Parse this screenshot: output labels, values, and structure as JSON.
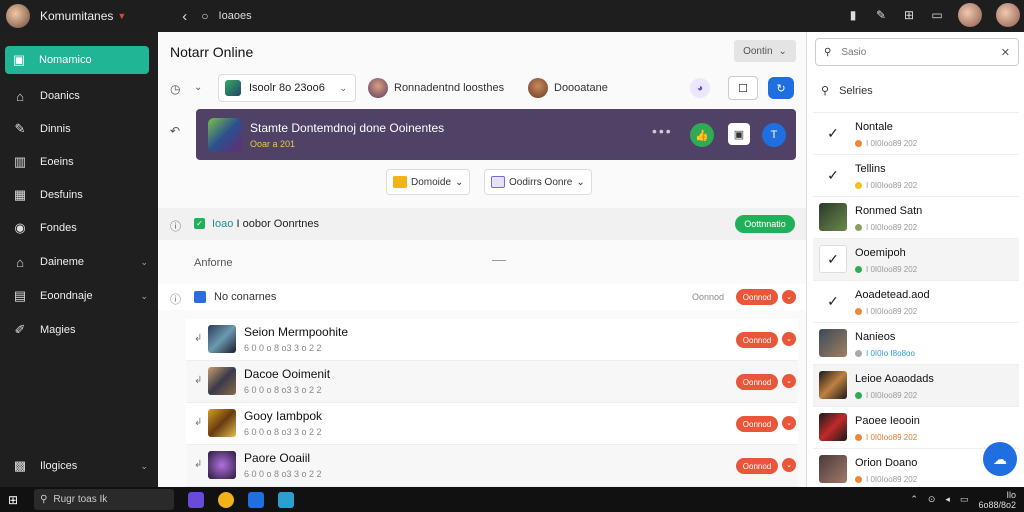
{
  "topbar": {
    "app_name": "Komumitanes",
    "search_text": "Ioaoes",
    "icons": [
      "back-icon",
      "search-icon",
      "bookmark-icon",
      "pin-icon",
      "grid-icon",
      "window-icon"
    ]
  },
  "sidebar": {
    "items": [
      {
        "label": "Nomamico",
        "icon": "chat-icon",
        "active": true
      },
      {
        "label": "Doanics",
        "icon": "home-icon"
      },
      {
        "label": "Dinnis",
        "icon": "pen-icon"
      },
      {
        "label": "Eoeins",
        "icon": "calendar-icon"
      },
      {
        "label": "Desfuins",
        "icon": "grid-icon"
      },
      {
        "label": "Fondes",
        "icon": "target-icon"
      },
      {
        "label": "Daineme",
        "icon": "home-icon"
      },
      {
        "label": "Eoondnaje",
        "icon": "box-icon"
      },
      {
        "label": "Magies",
        "icon": "pen-icon"
      },
      {
        "label": "Ilogices",
        "icon": "settings-icon"
      }
    ]
  },
  "main": {
    "title": "Notarr Online",
    "top_button": "Oontin",
    "select_value": "Isoolr 8o 23oo6",
    "person1": "Ronnadentnd loosthes",
    "person2": "Doooatane",
    "banner": {
      "title": "Stamte Dontemdnoj done Ooinentes",
      "subtitle": "Ooar a 201"
    },
    "dropdown1": "Domoide",
    "dropdown2": "Oodirrs Oonre",
    "group": {
      "label_hl": "Ioao",
      "label": "I oobor Oonrtnes",
      "pill": "Oottnnatio"
    },
    "archive_label": "Anforne",
    "list_header": "No conarnes",
    "list_header_small": "Oonnod",
    "rows": [
      {
        "name": "Seion Mermpoohite",
        "sub": "6 0 0 o 8 o3 3 o 2 2"
      },
      {
        "name": "Dacoe Ooimenit",
        "sub": "6 0 0 o 8 o3 3 o 2 2"
      },
      {
        "name": "Gooy Iambpok",
        "sub": "6 0 0 o 8 o3 3 o 2 2"
      },
      {
        "name": "Paore Ooaiil",
        "sub": "6 0 0 o 8 o3 3 o 2 2"
      }
    ],
    "row_button": "Oonnod"
  },
  "right_panel": {
    "search_placeholder": "Sasio",
    "section_title": "Selries",
    "items": [
      {
        "name": "Nontale",
        "sub": "I 0I0Ioo89 202",
        "dot": "#f0843a",
        "icon": "check-mark-icon"
      },
      {
        "name": "Tellins",
        "sub": "I 0I0Ioo89 202",
        "dot": "#f2c21a",
        "icon": "check-mark-icon"
      },
      {
        "name": "Ronmed Satn",
        "sub": "I 0I0Ioo89 202",
        "dot": "#8aa060",
        "icon": "game-icon"
      },
      {
        "name": "Ooemipoh",
        "sub": "I 0I0Ioo89 202",
        "dot": "#2faa55",
        "icon": "check-mark-icon"
      },
      {
        "name": "Aoadetead.aod",
        "sub": "I 0I0Ioo89 202",
        "dot": "#f0843a",
        "icon": "check-mark-icon"
      },
      {
        "name": "Nanieos",
        "sub": "I 0I0Io  I8o8oo",
        "dot": "#aaa",
        "icon": "game-icon"
      },
      {
        "name": "Leioe Aoaodads",
        "sub": "I 0I0Ioo89 202",
        "dot": "#2faa55",
        "icon": "game-icon"
      },
      {
        "name": "Paoee Ieooin",
        "sub": "I 0I0Ioo89 202",
        "dot": "#f0843a",
        "icon": "game-icon"
      },
      {
        "name": "Orion Doano",
        "sub": "I 0I0Ioo89 202",
        "dot": "#f0843a",
        "icon": "game-icon"
      }
    ]
  },
  "taskbar": {
    "search_text": "Rugr toas Ik",
    "time": "Ilo",
    "date": "6o88/8o2"
  }
}
